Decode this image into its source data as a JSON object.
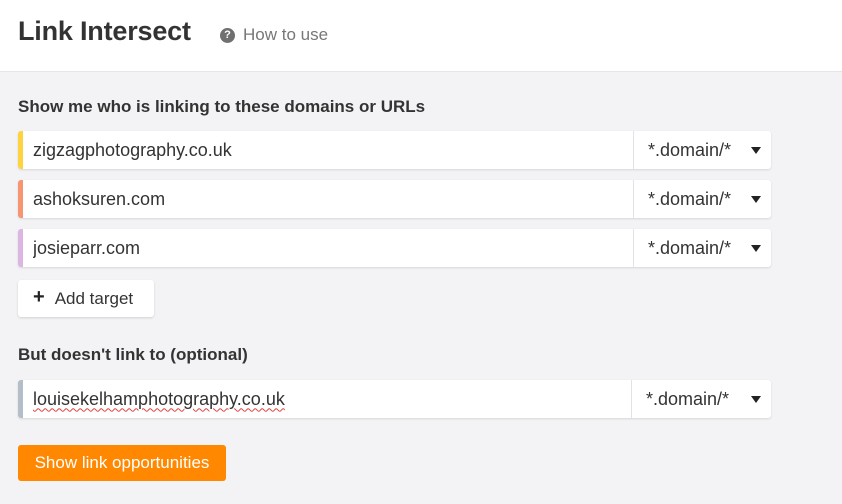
{
  "header": {
    "title": "Link Intersect",
    "how_to_label": "How to use"
  },
  "targets_section": {
    "label": "Show me who is linking to these domains or URLs",
    "rows": [
      {
        "value": "zigzagphotography.co.uk",
        "mode": "*.domain/*",
        "color": "#ffd23f"
      },
      {
        "value": "ashoksuren.com",
        "mode": "*.domain/*",
        "color": "#f79572"
      },
      {
        "value": "josieparr.com",
        "mode": "*.domain/*",
        "color": "#ddb5e2"
      }
    ],
    "add_target_label": "Add target"
  },
  "exclude_section": {
    "label": "But doesn't link to (optional)",
    "rows": [
      {
        "value": "louisekelhamphotography.co.uk",
        "mode": "*.domain/*",
        "color": "#b3bec8"
      }
    ]
  },
  "primary_button_label": "Show link opportunities",
  "colors": {
    "accent": "#ff8800"
  }
}
